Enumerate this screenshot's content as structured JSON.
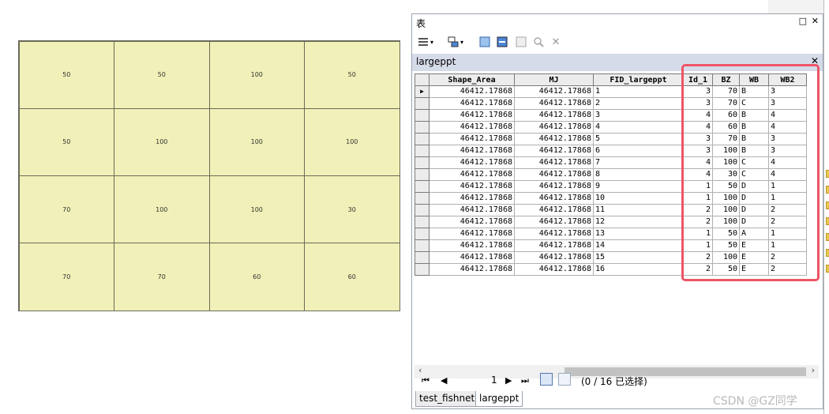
{
  "map": {
    "cells": [
      "50",
      "50",
      "100",
      "50",
      "50",
      "100",
      "100",
      "100",
      "70",
      "100",
      "100",
      "30",
      "70",
      "70",
      "60",
      "60"
    ]
  },
  "window": {
    "title": "表",
    "controls": {
      "restore": "□",
      "close": "✕"
    },
    "tab_title": "largeppt",
    "tab_close": "✕"
  },
  "toolbar": {
    "icons": [
      "table-options-icon",
      "related-tables-icon",
      "select-by-attributes-icon",
      "switch-selection-icon",
      "clear-selection-icon",
      "zoom-to-selected-icon",
      "delete-selected-icon"
    ]
  },
  "table": {
    "columns": [
      "Shape_Area",
      "MJ",
      "FID_largeppt",
      "Id_1",
      "BZ",
      "WB",
      "WB2"
    ],
    "rows": [
      [
        "46412.17868",
        "46412.17868",
        "1",
        "3",
        "70",
        "B",
        "3"
      ],
      [
        "46412.17868",
        "46412.17868",
        "2",
        "3",
        "70",
        "C",
        "3"
      ],
      [
        "46412.17868",
        "46412.17868",
        "3",
        "4",
        "60",
        "B",
        "4"
      ],
      [
        "46412.17868",
        "46412.17868",
        "4",
        "4",
        "60",
        "B",
        "4"
      ],
      [
        "46412.17868",
        "46412.17868",
        "5",
        "3",
        "70",
        "B",
        "3"
      ],
      [
        "46412.17868",
        "46412.17868",
        "6",
        "3",
        "100",
        "B",
        "3"
      ],
      [
        "46412.17868",
        "46412.17868",
        "7",
        "4",
        "100",
        "C",
        "4"
      ],
      [
        "46412.17868",
        "46412.17868",
        "8",
        "4",
        "30",
        "C",
        "4"
      ],
      [
        "46412.17868",
        "46412.17868",
        "9",
        "1",
        "50",
        "D",
        "1"
      ],
      [
        "46412.17868",
        "46412.17868",
        "10",
        "1",
        "100",
        "D",
        "1"
      ],
      [
        "46412.17868",
        "46412.17868",
        "11",
        "2",
        "100",
        "D",
        "2"
      ],
      [
        "46412.17868",
        "46412.17868",
        "12",
        "2",
        "100",
        "D",
        "2"
      ],
      [
        "46412.17868",
        "46412.17868",
        "13",
        "1",
        "50",
        "A",
        "1"
      ],
      [
        "46412.17868",
        "46412.17868",
        "14",
        "1",
        "50",
        "E",
        "1"
      ],
      [
        "46412.17868",
        "46412.17868",
        "15",
        "2",
        "100",
        "E",
        "2"
      ],
      [
        "46412.17868",
        "46412.17868",
        "16",
        "2",
        "50",
        "E",
        "2"
      ]
    ],
    "current_row_marker": "▶"
  },
  "nav": {
    "first": "⏮",
    "prev": "◀",
    "page": "1",
    "next": "▶",
    "last": "⏭",
    "status": "(0 / 16 已选择)"
  },
  "bottom_tabs": [
    "test_fishnet",
    "largeppt"
  ],
  "watermark": "CSDN @GZ同学",
  "colors": {
    "highlight": "#ee5566",
    "map_fill": "#f0f0b8",
    "tab_bar": "#d6dbe9"
  }
}
